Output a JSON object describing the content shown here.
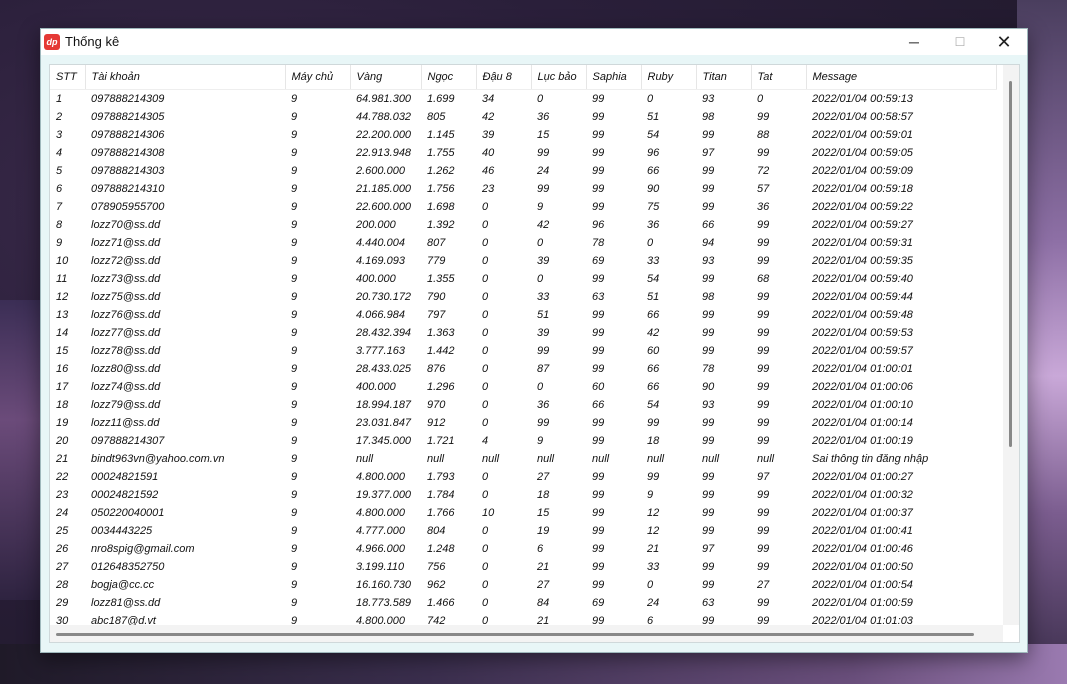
{
  "window": {
    "title": "Thống kê",
    "app_icon_text": "dp"
  },
  "columns": [
    "STT",
    "Tài khoản",
    "Máy chủ",
    "Vàng",
    "Ngọc",
    "Đậu 8",
    "Lục bảo",
    "Saphia",
    "Ruby",
    "Titan",
    "Tat",
    "Message"
  ],
  "rows": [
    [
      "1",
      "097888214309",
      "9",
      "64.981.300",
      "1.699",
      "34",
      "0",
      "99",
      "0",
      "93",
      "0",
      "2022/01/04 00:59:13"
    ],
    [
      "2",
      "097888214305",
      "9",
      "44.788.032",
      "805",
      "42",
      "36",
      "99",
      "51",
      "98",
      "99",
      "2022/01/04 00:58:57"
    ],
    [
      "3",
      "097888214306",
      "9",
      "22.200.000",
      "1.145",
      "39",
      "15",
      "99",
      "54",
      "99",
      "88",
      "2022/01/04 00:59:01"
    ],
    [
      "4",
      "097888214308",
      "9",
      "22.913.948",
      "1.755",
      "40",
      "99",
      "99",
      "96",
      "97",
      "99",
      "2022/01/04 00:59:05"
    ],
    [
      "5",
      "097888214303",
      "9",
      "2.600.000",
      "1.262",
      "46",
      "24",
      "99",
      "66",
      "99",
      "72",
      "2022/01/04 00:59:09"
    ],
    [
      "6",
      "097888214310",
      "9",
      "21.185.000",
      "1.756",
      "23",
      "99",
      "99",
      "90",
      "99",
      "57",
      "2022/01/04 00:59:18"
    ],
    [
      "7",
      "078905955700",
      "9",
      "22.600.000",
      "1.698",
      "0",
      "9",
      "99",
      "75",
      "99",
      "36",
      "2022/01/04 00:59:22"
    ],
    [
      "8",
      "lozz70@ss.dd",
      "9",
      "200.000",
      "1.392",
      "0",
      "42",
      "96",
      "36",
      "66",
      "99",
      "2022/01/04 00:59:27"
    ],
    [
      "9",
      "lozz71@ss.dd",
      "9",
      "4.440.004",
      "807",
      "0",
      "0",
      "78",
      "0",
      "94",
      "99",
      "2022/01/04 00:59:31"
    ],
    [
      "10",
      "lozz72@ss.dd",
      "9",
      "4.169.093",
      "779",
      "0",
      "39",
      "69",
      "33",
      "93",
      "99",
      "2022/01/04 00:59:35"
    ],
    [
      "11",
      "lozz73@ss.dd",
      "9",
      "400.000",
      "1.355",
      "0",
      "0",
      "99",
      "54",
      "99",
      "68",
      "2022/01/04 00:59:40"
    ],
    [
      "12",
      "lozz75@ss.dd",
      "9",
      "20.730.172",
      "790",
      "0",
      "33",
      "63",
      "51",
      "98",
      "99",
      "2022/01/04 00:59:44"
    ],
    [
      "13",
      "lozz76@ss.dd",
      "9",
      "4.066.984",
      "797",
      "0",
      "51",
      "99",
      "66",
      "99",
      "99",
      "2022/01/04 00:59:48"
    ],
    [
      "14",
      "lozz77@ss.dd",
      "9",
      "28.432.394",
      "1.363",
      "0",
      "39",
      "99",
      "42",
      "99",
      "99",
      "2022/01/04 00:59:53"
    ],
    [
      "15",
      "lozz78@ss.dd",
      "9",
      "3.777.163",
      "1.442",
      "0",
      "99",
      "99",
      "60",
      "99",
      "99",
      "2022/01/04 00:59:57"
    ],
    [
      "16",
      "lozz80@ss.dd",
      "9",
      "28.433.025",
      "876",
      "0",
      "87",
      "99",
      "66",
      "78",
      "99",
      "2022/01/04 01:00:01"
    ],
    [
      "17",
      "lozz74@ss.dd",
      "9",
      "400.000",
      "1.296",
      "0",
      "0",
      "60",
      "66",
      "90",
      "99",
      "2022/01/04 01:00:06"
    ],
    [
      "18",
      "lozz79@ss.dd",
      "9",
      "18.994.187",
      "970",
      "0",
      "36",
      "66",
      "54",
      "93",
      "99",
      "2022/01/04 01:00:10"
    ],
    [
      "19",
      "lozz11@ss.dd",
      "9",
      "23.031.847",
      "912",
      "0",
      "99",
      "99",
      "99",
      "99",
      "99",
      "2022/01/04 01:00:14"
    ],
    [
      "20",
      "097888214307",
      "9",
      "17.345.000",
      "1.721",
      "4",
      "9",
      "99",
      "18",
      "99",
      "99",
      "2022/01/04 01:00:19"
    ],
    [
      "21",
      "bindt963vn@yahoo.com.vn",
      "9",
      "null",
      "null",
      "null",
      "null",
      "null",
      "null",
      "null",
      "null",
      "Sai thông tin đăng nhập"
    ],
    [
      "22",
      "00024821591",
      "9",
      "4.800.000",
      "1.793",
      "0",
      "27",
      "99",
      "99",
      "99",
      "97",
      "2022/01/04 01:00:27"
    ],
    [
      "23",
      "00024821592",
      "9",
      "19.377.000",
      "1.784",
      "0",
      "18",
      "99",
      "9",
      "99",
      "99",
      "2022/01/04 01:00:32"
    ],
    [
      "24",
      "050220040001",
      "9",
      "4.800.000",
      "1.766",
      "10",
      "15",
      "99",
      "12",
      "99",
      "99",
      "2022/01/04 01:00:37"
    ],
    [
      "25",
      "0034443225",
      "9",
      "4.777.000",
      "804",
      "0",
      "19",
      "99",
      "12",
      "99",
      "99",
      "2022/01/04 01:00:41"
    ],
    [
      "26",
      "nro8spig@gmail.com",
      "9",
      "4.966.000",
      "1.248",
      "0",
      "6",
      "99",
      "21",
      "97",
      "99",
      "2022/01/04 01:00:46"
    ],
    [
      "27",
      "012648352750",
      "9",
      "3.199.110",
      "756",
      "0",
      "21",
      "99",
      "33",
      "99",
      "99",
      "2022/01/04 01:00:50"
    ],
    [
      "28",
      "bogja@cc.cc",
      "9",
      "16.160.730",
      "962",
      "0",
      "27",
      "99",
      "0",
      "99",
      "27",
      "2022/01/04 01:00:54"
    ],
    [
      "29",
      "lozz81@ss.dd",
      "9",
      "18.773.589",
      "1.466",
      "0",
      "84",
      "69",
      "24",
      "63",
      "99",
      "2022/01/04 01:00:59"
    ],
    [
      "30",
      "abc187@d.vt",
      "9",
      "4.800.000",
      "742",
      "0",
      "21",
      "99",
      "6",
      "99",
      "99",
      "2022/01/04 01:01:03"
    ]
  ]
}
